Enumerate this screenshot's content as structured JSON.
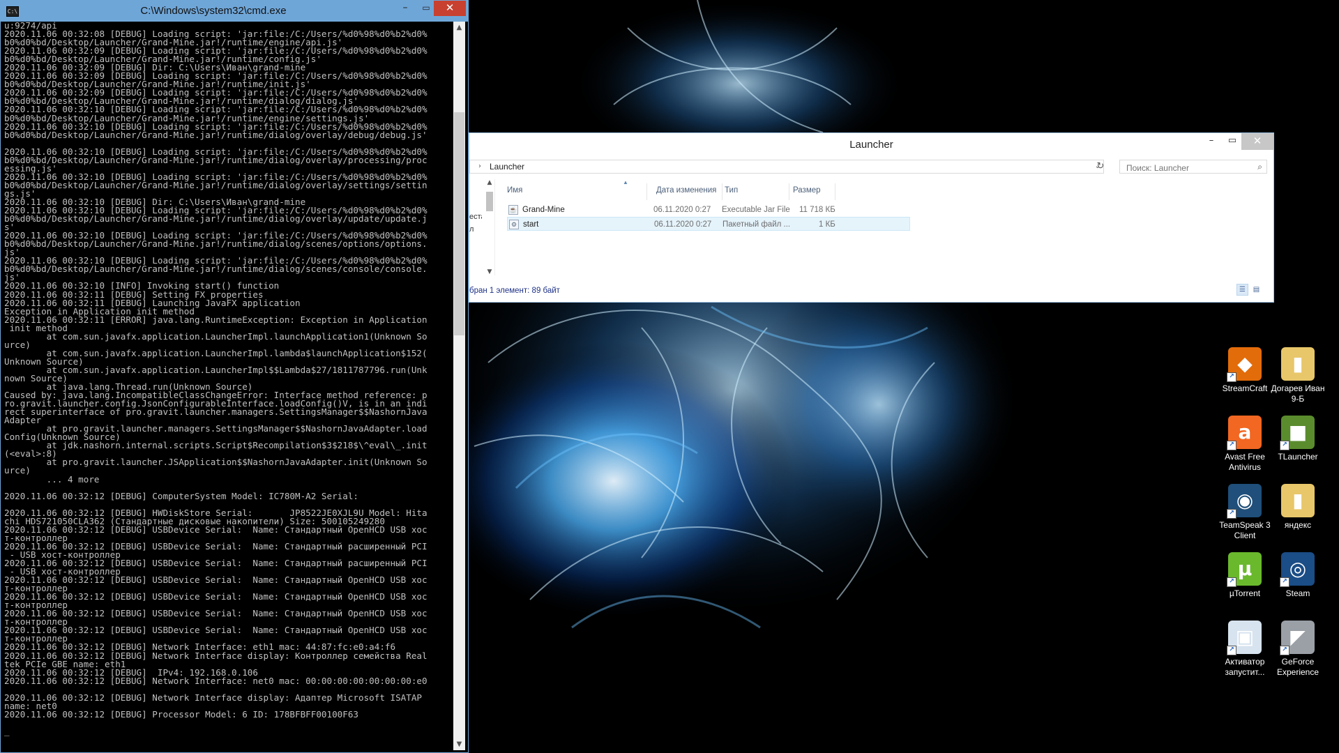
{
  "cmd": {
    "title": "C:\\Windows\\system32\\cmd.exe",
    "icon": "C:\\",
    "lines": [
      "u:9274/api",
      "2020.11.06 00:32:08 [DEBUG] Loading script: 'jar:file:/C:/Users/%d0%98%d0%b2%d0%",
      "b0%d0%bd/Desktop/Launcher/Grand-Mine.jar!/runtime/engine/api.js'",
      "2020.11.06 00:32:09 [DEBUG] Loading script: 'jar:file:/C:/Users/%d0%98%d0%b2%d0%",
      "b0%d0%bd/Desktop/Launcher/Grand-Mine.jar!/runtime/config.js'",
      "2020.11.06 00:32:09 [DEBUG] Dir: C:\\Users\\Иван\\grand-mine",
      "2020.11.06 00:32:09 [DEBUG] Loading script: 'jar:file:/C:/Users/%d0%98%d0%b2%d0%",
      "b0%d0%bd/Desktop/Launcher/Grand-Mine.jar!/runtime/init.js'",
      "2020.11.06 00:32:09 [DEBUG] Loading script: 'jar:file:/C:/Users/%d0%98%d0%b2%d0%",
      "b0%d0%bd/Desktop/Launcher/Grand-Mine.jar!/runtime/dialog/dialog.js'",
      "2020.11.06 00:32:10 [DEBUG] Loading script: 'jar:file:/C:/Users/%d0%98%d0%b2%d0%",
      "b0%d0%bd/Desktop/Launcher/Grand-Mine.jar!/runtime/engine/settings.js'",
      "2020.11.06 00:32:10 [DEBUG] Loading script: 'jar:file:/C:/Users/%d0%98%d0%b2%d0%",
      "b0%d0%bd/Desktop/Launcher/Grand-Mine.jar!/runtime/dialog/overlay/debug/debug.js'",
      "",
      "2020.11.06 00:32:10 [DEBUG] Loading script: 'jar:file:/C:/Users/%d0%98%d0%b2%d0%",
      "b0%d0%bd/Desktop/Launcher/Grand-Mine.jar!/runtime/dialog/overlay/processing/proc",
      "essing.js'",
      "2020.11.06 00:32:10 [DEBUG] Loading script: 'jar:file:/C:/Users/%d0%98%d0%b2%d0%",
      "b0%d0%bd/Desktop/Launcher/Grand-Mine.jar!/runtime/dialog/overlay/settings/settin",
      "gs.js'",
      "2020.11.06 00:32:10 [DEBUG] Dir: C:\\Users\\Иван\\grand-mine",
      "2020.11.06 00:32:10 [DEBUG] Loading script: 'jar:file:/C:/Users/%d0%98%d0%b2%d0%",
      "b0%d0%bd/Desktop/Launcher/Grand-Mine.jar!/runtime/dialog/overlay/update/update.j",
      "s'",
      "2020.11.06 00:32:10 [DEBUG] Loading script: 'jar:file:/C:/Users/%d0%98%d0%b2%d0%",
      "b0%d0%bd/Desktop/Launcher/Grand-Mine.jar!/runtime/dialog/scenes/options/options.",
      "js'",
      "2020.11.06 00:32:10 [DEBUG] Loading script: 'jar:file:/C:/Users/%d0%98%d0%b2%d0%",
      "b0%d0%bd/Desktop/Launcher/Grand-Mine.jar!/runtime/dialog/scenes/console/console.",
      "js'",
      "2020.11.06 00:32:10 [INFO] Invoking start() function",
      "2020.11.06 00:32:11 [DEBUG] Setting FX properties",
      "2020.11.06 00:32:11 [DEBUG] Launching JavaFX application",
      "Exception in Application init method",
      "2020.11.06 00:32:11 [ERROR] java.lang.RuntimeException: Exception in Application",
      " init method",
      "        at com.sun.javafx.application.LauncherImpl.launchApplication1(Unknown So",
      "urce)",
      "        at com.sun.javafx.application.LauncherImpl.lambda$launchApplication$152(",
      "Unknown Source)",
      "        at com.sun.javafx.application.LauncherImpl$$Lambda$27/1811787796.run(Unk",
      "nown Source)",
      "        at java.lang.Thread.run(Unknown Source)",
      "Caused by: java.lang.IncompatibleClassChangeError: Interface method reference: p",
      "ro.gravit.launcher.config.JsonConfigurableInterface.loadConfig()V, is in an indi",
      "rect superinterface of pro.gravit.launcher.managers.SettingsManager$$NashornJava",
      "Adapter",
      "        at pro.gravit.launcher.managers.SettingsManager$$NashornJavaAdapter.load",
      "Config(Unknown Source)",
      "        at jdk.nashorn.internal.scripts.Script$Recompilation$3$218$\\^eval\\_.init",
      "(<eval>:8)",
      "        at pro.gravit.launcher.JSApplication$$NashornJavaAdapter.init(Unknown So",
      "urce)",
      "        ... 4 more",
      "",
      "2020.11.06 00:32:12 [DEBUG] ComputerSystem Model: IC780M-A2 Serial:",
      "",
      "2020.11.06 00:32:12 [DEBUG] HWDiskStore Serial:       JP8522JE0XJL9U Model: Hita",
      "chi HDS721050CLA362 (Стандартные дисковые накопители) Size: 500105249280",
      "2020.11.06 00:32:12 [DEBUG] USBDevice Serial:  Name: Стандартный OpenHCD USB хос",
      "т-контроллер",
      "2020.11.06 00:32:12 [DEBUG] USBDevice Serial:  Name: Стандартный расширенный PCI",
      " - USB хост-контроллер",
      "2020.11.06 00:32:12 [DEBUG] USBDevice Serial:  Name: Стандартный расширенный PCI",
      " - USB хост-контроллер",
      "2020.11.06 00:32:12 [DEBUG] USBDevice Serial:  Name: Стандартный OpenHCD USB хос",
      "т-контроллер",
      "2020.11.06 00:32:12 [DEBUG] USBDevice Serial:  Name: Стандартный OpenHCD USB хос",
      "т-контроллер",
      "2020.11.06 00:32:12 [DEBUG] USBDevice Serial:  Name: Стандартный OpenHCD USB хос",
      "т-контроллер",
      "2020.11.06 00:32:12 [DEBUG] USBDevice Serial:  Name: Стандартный OpenHCD USB хос",
      "т-контроллер",
      "2020.11.06 00:32:12 [DEBUG] Network Interface: eth1 mac: 44:87:fc:e0:a4:f6",
      "2020.11.06 00:32:12 [DEBUG] Network Interface display: Контроллер семейства Real",
      "tek PCIe GBE name: eth1",
      "2020.11.06 00:32:12 [DEBUG]  IPv4: 192.168.0.106",
      "2020.11.06 00:32:12 [DEBUG] Network Interface: net0 mac: 00:00:00:00:00:00:00:e0",
      "",
      "2020.11.06 00:32:12 [DEBUG] Network Interface display: Адаптер Microsoft ISATAP",
      "name: net0",
      "2020.11.06 00:32:12 [DEBUG] Processor Model: 6 ID: 178BFBFF00100F63",
      "",
      "_"
    ],
    "controls": {
      "minimize": "–",
      "maximize": "▭",
      "close": "✕"
    },
    "scroll": {
      "up": "▲",
      "down": "▼"
    }
  },
  "explorer": {
    "title": "Launcher",
    "controls": {
      "minimize": "–",
      "maximize": "▭",
      "close": "✕"
    },
    "address": {
      "chevron": "›",
      "path": "Launcher",
      "dropdown": "⌄"
    },
    "refresh": "↻",
    "search": {
      "placeholder": "Поиск: Launcher",
      "icon": "⌕"
    },
    "nav": [
      "еста",
      "л"
    ],
    "columns": {
      "name": "Имя",
      "date": "Дата изменения",
      "type": "Тип",
      "size": "Размер"
    },
    "files": [
      {
        "name": "Grand-Mine",
        "date": "06.11.2020 0:27",
        "type": "Executable Jar File",
        "size": "11 718 КБ",
        "icon": "jar-file-icon"
      },
      {
        "name": "start",
        "date": "06.11.2020 0:27",
        "type": "Пакетный файл ...",
        "size": "1 КБ",
        "icon": "batch-file-icon"
      }
    ],
    "status": "бран 1 элемент: 89 байт",
    "view_buttons": {
      "details": "☰",
      "tiles": "▤"
    }
  },
  "desktop_icons": [
    {
      "label": "StreamCraft",
      "glyph": "◆",
      "color": "#e36c0a",
      "shortcut": true
    },
    {
      "label": "Догарев Иван 9-Б",
      "glyph": "▮",
      "color": "#e8c76a",
      "shortcut": false
    },
    {
      "label": "Avast Free Antivirus",
      "glyph": "a",
      "color": "#f26722",
      "shortcut": true
    },
    {
      "label": "TLauncher",
      "glyph": "■",
      "color": "#5a8c2e",
      "shortcut": true
    },
    {
      "label": "TeamSpeak 3 Client",
      "glyph": "◉",
      "color": "#1f4f7a",
      "shortcut": true
    },
    {
      "label": "яндекс",
      "glyph": "▮",
      "color": "#e8c76a",
      "shortcut": false
    },
    {
      "label": "µTorrent",
      "glyph": "µ",
      "color": "#6ab92d",
      "shortcut": true
    },
    {
      "label": "Steam",
      "glyph": "◎",
      "color": "#1b4d86",
      "shortcut": true
    },
    {
      "label": "Активатор запустит...",
      "glyph": "▣",
      "color": "#d7e3ef",
      "shortcut": true
    },
    {
      "label": "GeForce Experience",
      "glyph": "◤",
      "color": "#9aa0a6",
      "shortcut": true
    }
  ]
}
